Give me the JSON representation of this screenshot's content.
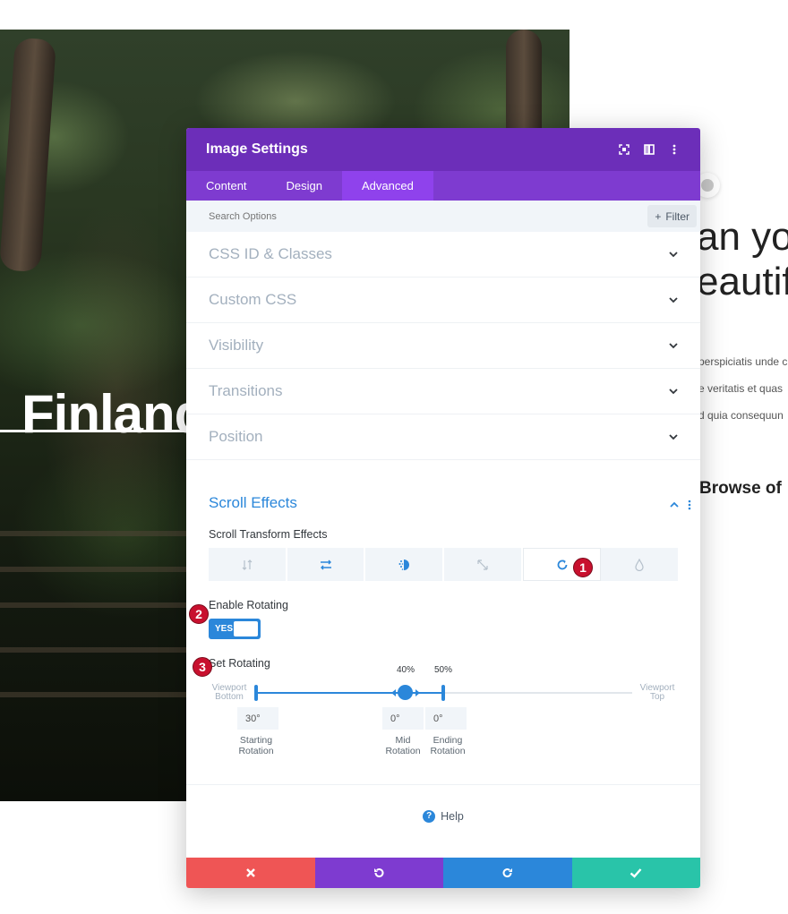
{
  "background": {
    "hero_title": "Finland",
    "heading_right_lines": [
      "an yo",
      "eautif"
    ],
    "paragraph_lines": [
      "perspiciatis unde c",
      "e veritatis et quas",
      "d quia consequun"
    ],
    "browse_text": "Browse of"
  },
  "modal": {
    "title": "Image Settings",
    "header_icons": [
      "expand-icon",
      "split-view-icon",
      "more-icon"
    ],
    "tabs": [
      {
        "label": "Content",
        "active": false
      },
      {
        "label": "Design",
        "active": false
      },
      {
        "label": "Advanced",
        "active": true
      }
    ],
    "search": {
      "placeholder": "Search Options",
      "filter_label": "Filter"
    },
    "sections": [
      {
        "label": "CSS ID & Classes"
      },
      {
        "label": "Custom CSS"
      },
      {
        "label": "Visibility"
      },
      {
        "label": "Transitions"
      },
      {
        "label": "Position"
      }
    ],
    "scroll_effects": {
      "title": "Scroll Effects",
      "transform_label": "Scroll Transform Effects",
      "effects": [
        "vertical-motion-icon",
        "horizontal-motion-icon",
        "fade-icon",
        "scale-icon",
        "rotate-icon",
        "blur-icon"
      ],
      "active_effect": "rotate-icon",
      "enable_label": "Enable Rotating",
      "toggle_text": "YES",
      "set_label": "Set Rotating",
      "viewport_bottom": [
        "Viewport",
        "Bottom"
      ],
      "viewport_top": [
        "Viewport",
        "Top"
      ],
      "mid_percent": "40%",
      "end_percent": "50%",
      "starting_value": "30°",
      "mid_value": "0°",
      "ending_value": "0°",
      "starting_label": [
        "Starting",
        "Rotation"
      ],
      "mid_label": [
        "Mid",
        "Rotation"
      ],
      "ending_label": [
        "Ending",
        "Rotation"
      ]
    },
    "badges": [
      "1",
      "2",
      "3"
    ],
    "help_label": "Help",
    "footer_colors": {
      "discard": "#ef5555",
      "undo": "#7e3bd0",
      "redo": "#2b87da",
      "save": "#29c4a9"
    }
  }
}
